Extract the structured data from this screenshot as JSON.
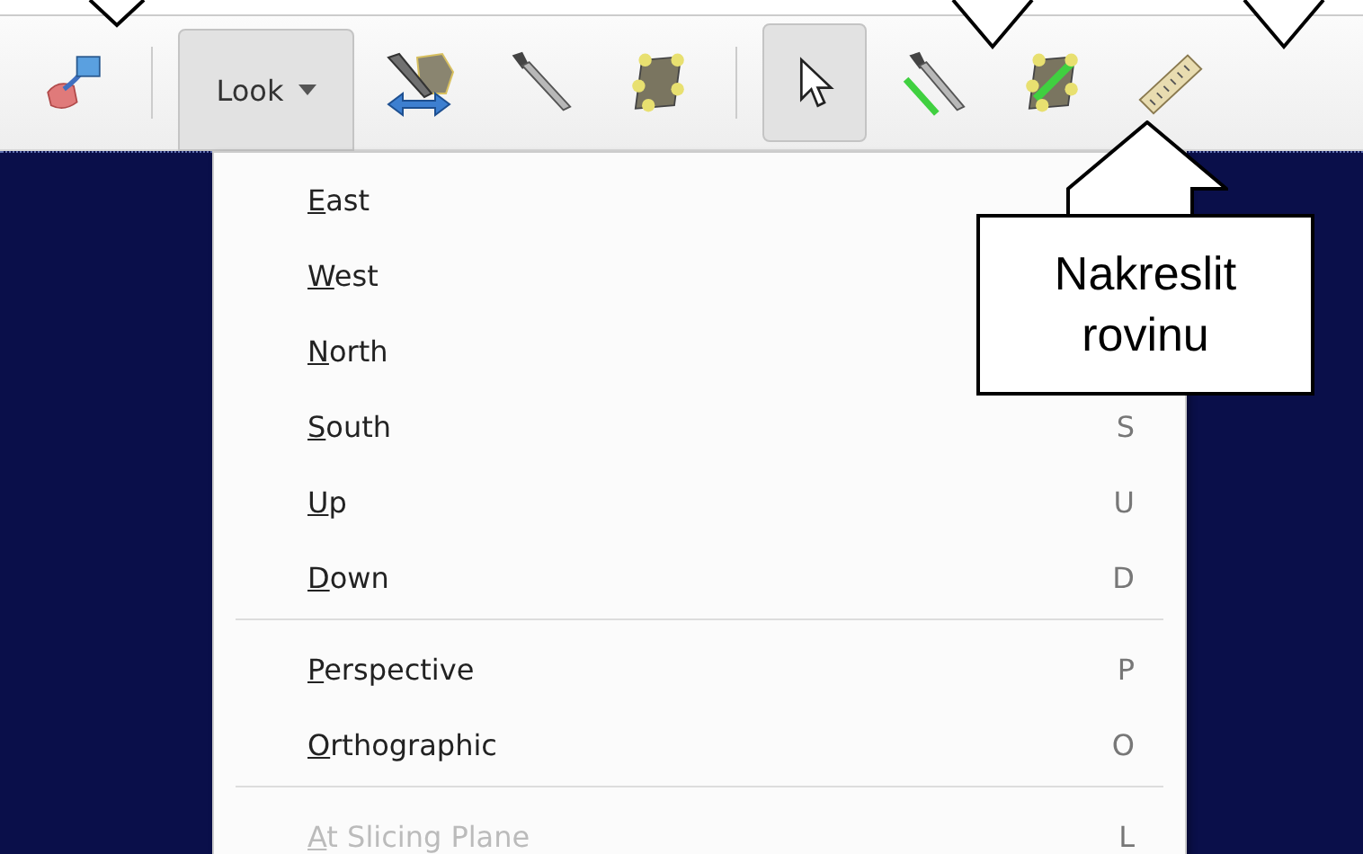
{
  "toolbar": {
    "items": [
      {
        "kind": "move",
        "selected": false
      },
      {
        "kind": "separator"
      },
      {
        "kind": "dropdown",
        "label": "Look",
        "selected": true
      },
      {
        "kind": "split",
        "selected": false
      },
      {
        "kind": "knife",
        "selected": false
      },
      {
        "kind": "plane",
        "selected": false
      },
      {
        "kind": "separator"
      },
      {
        "kind": "pointer",
        "selected": true
      },
      {
        "kind": "slice",
        "selected": false
      },
      {
        "kind": "draw-plane",
        "selected": false
      },
      {
        "kind": "ruler",
        "selected": false
      }
    ]
  },
  "menu": {
    "sections": [
      {
        "items": [
          {
            "label": "East",
            "disabled": false
          },
          {
            "label": "West",
            "disabled": false
          },
          {
            "label": "North",
            "disabled": false
          },
          {
            "label": "South",
            "shortcut": "S",
            "disabled": false
          },
          {
            "label": "Up",
            "shortcut": "U",
            "disabled": false
          },
          {
            "label": "Down",
            "shortcut": "D",
            "disabled": false
          }
        ]
      },
      {
        "items": [
          {
            "label": "Perspective",
            "shortcut": "P",
            "disabled": false
          },
          {
            "label": "Orthographic",
            "shortcut": "O",
            "disabled": false
          }
        ]
      },
      {
        "items": [
          {
            "label": "At Slicing Plane",
            "shortcut": "L",
            "disabled": true
          }
        ]
      }
    ]
  },
  "callout": {
    "text": "Nakreslit rovinu"
  }
}
